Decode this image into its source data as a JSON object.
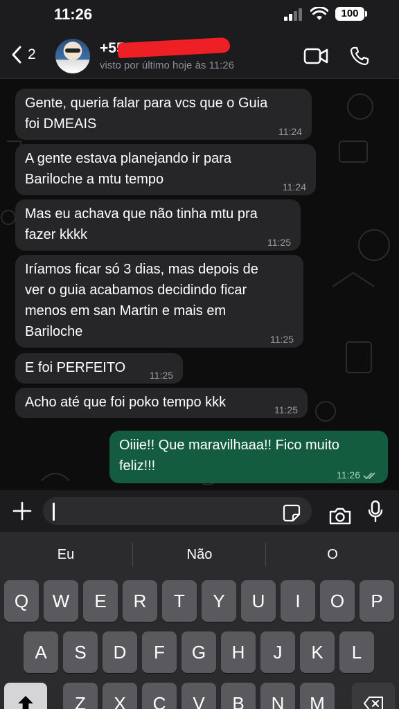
{
  "status_bar": {
    "time": "11:26",
    "battery": "100"
  },
  "header": {
    "back_count": "2",
    "contact_name": "+55",
    "last_seen": "visto por último hoje às 11:26"
  },
  "messages": [
    {
      "direction": "in",
      "text": "Gente, queria falar para vcs que o Guia foi DMEAIS",
      "lines": [
        "Gente, queria falar para vcs que o Guia",
        "foi DMEAIS"
      ],
      "time": "11:24"
    },
    {
      "direction": "in",
      "text": "A gente estava planejando ir para Bariloche a mtu tempo",
      "lines": [
        "A gente estava planejando ir para",
        "Bariloche a mtu tempo"
      ],
      "time": "11:24"
    },
    {
      "direction": "in",
      "text": "Mas eu achava que não tinha mtu pra fazer kkkk",
      "lines": [
        "Mas eu achava que não tinha mtu pra",
        "fazer kkkk"
      ],
      "time": "11:25"
    },
    {
      "direction": "in",
      "text": "Iríamos ficar só 3 dias, mas depois de ver o guia acabamos decidindo ficar menos em san Martin e mais em Bariloche",
      "lines": [
        "Iríamos ficar só 3 dias, mas depois de",
        "ver o guia acabamos decidindo ficar",
        "menos em san Martin e mais em",
        "Bariloche"
      ],
      "time": "11:25"
    },
    {
      "direction": "in",
      "text": "E foi PERFEITO",
      "lines": [
        "E foi PERFEITO"
      ],
      "time": "11:25"
    },
    {
      "direction": "in",
      "text": "Acho até que foi poko tempo kkk",
      "lines": [
        "Acho até que foi poko tempo kkk"
      ],
      "time": "11:25"
    },
    {
      "direction": "out",
      "text": "Oiiie!! Que maravilhaaa!! Fico muito feliz!!!",
      "lines": [
        "Oiiie!! Que maravilhaaa!! Fico muito",
        "feliz!!!"
      ],
      "time": "11:26",
      "status": "read"
    }
  ],
  "input": {
    "value": "",
    "placeholder": ""
  },
  "keyboard": {
    "suggestions": [
      "Eu",
      "Não",
      "O"
    ],
    "row1": [
      "Q",
      "W",
      "E",
      "R",
      "T",
      "Y",
      "U",
      "I",
      "O",
      "P"
    ],
    "row2": [
      "A",
      "S",
      "D",
      "F",
      "G",
      "H",
      "J",
      "K",
      "L"
    ],
    "row3": [
      "Z",
      "X",
      "C",
      "V",
      "B",
      "N",
      "M"
    ]
  },
  "colors": {
    "incoming_bubble": "#262628",
    "outgoing_bubble": "#135c3f",
    "background": "#0d0d0d",
    "redaction": "#ef1f26"
  }
}
